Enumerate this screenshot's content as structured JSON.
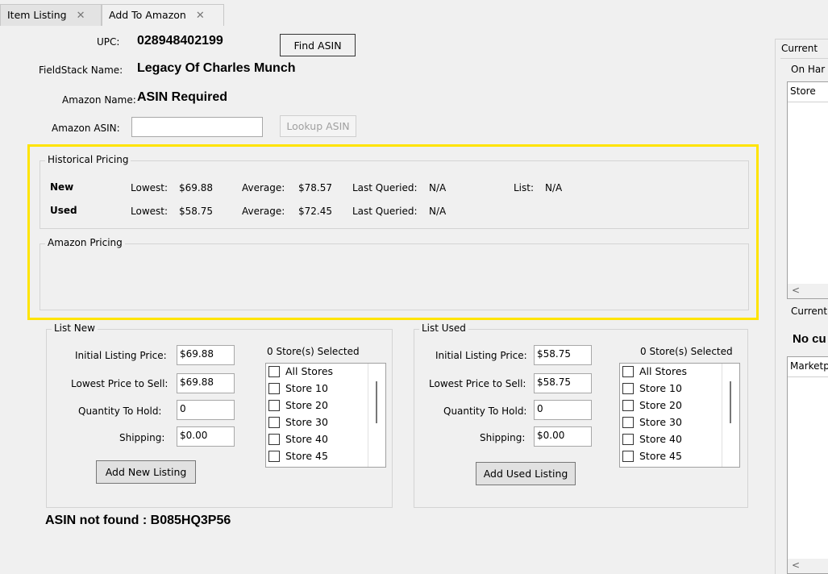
{
  "tabs": [
    {
      "label": "Item Listing",
      "close": "✕"
    },
    {
      "label": "Add To Amazon",
      "close": "✕"
    }
  ],
  "form": {
    "upc_label": "UPC:",
    "upc_value": "028948402199",
    "find_asin_label": "Find ASIN",
    "fieldstack_label": "FieldStack Name:",
    "fieldstack_value": "Legacy Of Charles Munch",
    "amazon_name_label": "Amazon Name:",
    "amazon_name_value": "ASIN Required",
    "amazon_asin_label": "Amazon ASIN:",
    "amazon_asin_value": "",
    "lookup_asin_label": "Lookup ASIN"
  },
  "historical": {
    "title": "Historical Pricing",
    "new": {
      "label": "New",
      "lowest_label": "Lowest:",
      "lowest": "$69.88",
      "average_label": "Average:",
      "average": "$78.57",
      "last_queried_label": "Last Queried:",
      "last_queried": "N/A",
      "list_label": "List:",
      "list": "N/A"
    },
    "used": {
      "label": "Used",
      "lowest_label": "Lowest:",
      "lowest": "$58.75",
      "average_label": "Average:",
      "average": "$72.45",
      "last_queried_label": "Last Queried:",
      "last_queried": "N/A"
    }
  },
  "amazon_pricing": {
    "title": "Amazon Pricing"
  },
  "list_new": {
    "title": "List New",
    "initial_label": "Initial Listing Price:",
    "initial_value": "$69.88",
    "lowest_label": "Lowest Price to Sell:",
    "lowest_value": "$69.88",
    "qty_label": "Quantity To Hold:",
    "qty_value": "0",
    "shipping_label": "Shipping:",
    "shipping_value": "$0.00",
    "stores_selected": "0 Store(s) Selected",
    "stores": [
      "All Stores",
      "Store 10",
      "Store 20",
      "Store 30",
      "Store 40",
      "Store 45"
    ],
    "button": "Add New Listing"
  },
  "list_used": {
    "title": "List Used",
    "initial_label": "Initial Listing Price:",
    "initial_value": "$58.75",
    "lowest_label": "Lowest Price to Sell:",
    "lowest_value": "$58.75",
    "qty_label": "Quantity To Hold:",
    "qty_value": "0",
    "shipping_label": "Shipping:",
    "shipping_value": "$0.00",
    "stores_selected": "0 Store(s) Selected",
    "stores": [
      "All Stores",
      "Store 10",
      "Store 20",
      "Store 30",
      "Store 40",
      "Store 45"
    ],
    "button": "Add Used Listing"
  },
  "status_message": "ASIN not found : B085HQ3P56",
  "right": {
    "current_label": "Current",
    "on_hand_label": "On Har",
    "store_col": "Store",
    "current2_label": "Current",
    "no_label": "No cu",
    "marketplace_col": "Marketp",
    "scroll_left": "<"
  },
  "colors": {
    "highlight": "#ffe400",
    "background": "#f0f0f0"
  }
}
